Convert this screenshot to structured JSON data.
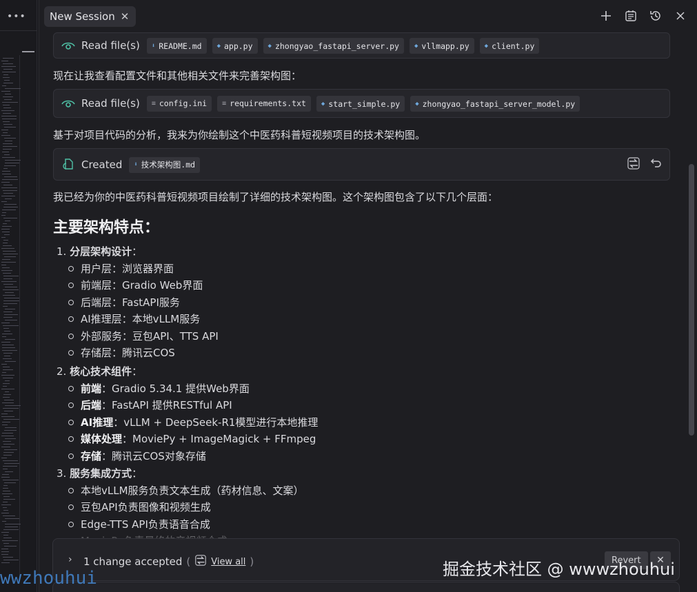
{
  "tab": {
    "title": "New Session",
    "close": "✕"
  },
  "toolbar": {
    "add": "+",
    "tasks": "☰",
    "history": "⟲",
    "close": "✕"
  },
  "cards": [
    {
      "label": "Read file(s)",
      "icon": "eye-icon",
      "files": [
        {
          "name": "README.md",
          "type": "download"
        },
        {
          "name": "app.py",
          "type": "python"
        },
        {
          "name": "zhongyao_fastapi_server.py",
          "type": "python"
        },
        {
          "name": "vllmapp.py",
          "type": "python"
        },
        {
          "name": "client.py",
          "type": "python"
        }
      ]
    },
    {
      "label": "Read file(s)",
      "icon": "eye-icon",
      "files": [
        {
          "name": "config.ini",
          "type": "text"
        },
        {
          "name": "requirements.txt",
          "type": "text"
        },
        {
          "name": "start_simple.py",
          "type": "python"
        },
        {
          "name": "zhongyao_fastapi_server_model.py",
          "type": "python"
        }
      ]
    },
    {
      "label": "Created",
      "icon": "file-sync-icon",
      "files": [
        {
          "name": "技术架构图.md",
          "type": "download"
        }
      ]
    }
  ],
  "paragraphs": {
    "p1": "现在让我查看配置文件和其他相关文件来完善架构图：",
    "p2": "基于对项目代码的分析，我来为你绘制这个中医药科普短视频项目的技术架构图。",
    "p3": "我已经为你的中医药科普短视频项目绘制了详细的技术架构图。这个架构图包含了以下几个层面："
  },
  "heading": "主要架构特点：",
  "sections": [
    {
      "num": "1.",
      "title": "分层架构设计",
      "items": [
        {
          "bold": "",
          "text": "用户层：浏览器界面"
        },
        {
          "bold": "",
          "text": "前端层：Gradio Web界面"
        },
        {
          "bold": "",
          "text": "后端层：FastAPI服务"
        },
        {
          "bold": "",
          "text": "AI推理层：本地vLLM服务"
        },
        {
          "bold": "",
          "text": "外部服务：豆包API、TTS API"
        },
        {
          "bold": "",
          "text": "存储层：腾讯云COS"
        }
      ]
    },
    {
      "num": "2.",
      "title": "核心技术组件",
      "items": [
        {
          "bold": "前端",
          "text": "：Gradio 5.34.1 提供Web界面"
        },
        {
          "bold": "后端",
          "text": "：FastAPI 提供RESTful API"
        },
        {
          "bold": "AI推理",
          "text": "：vLLM + DeepSeek-R1模型进行本地推理"
        },
        {
          "bold": "媒体处理",
          "text": "：MoviePy + ImageMagick + FFmpeg"
        },
        {
          "bold": "存储",
          "text": "：腾讯云COS对象存储"
        }
      ]
    },
    {
      "num": "3.",
      "title": "服务集成方式",
      "items": [
        {
          "bold": "",
          "text": "本地vLLM服务负责文本生成（药材信息、文案）"
        },
        {
          "bold": "",
          "text": "豆包API负责图像和视频生成"
        },
        {
          "bold": "",
          "text": "Edge-TTS API负责语音合成"
        },
        {
          "bold": "",
          "text": "MoviePy负责最终的音视频合成"
        }
      ]
    }
  ],
  "bottom": {
    "chevron": "›",
    "accepted": "1 change accepted",
    "open_paren": "(",
    "close_paren": ")",
    "view_all": "View all",
    "revert": "Revert",
    "dismiss": "✕"
  },
  "watermark": "掘金技术社区 @ wwwzhouhui",
  "watermark_left": "wwzhouhui"
}
